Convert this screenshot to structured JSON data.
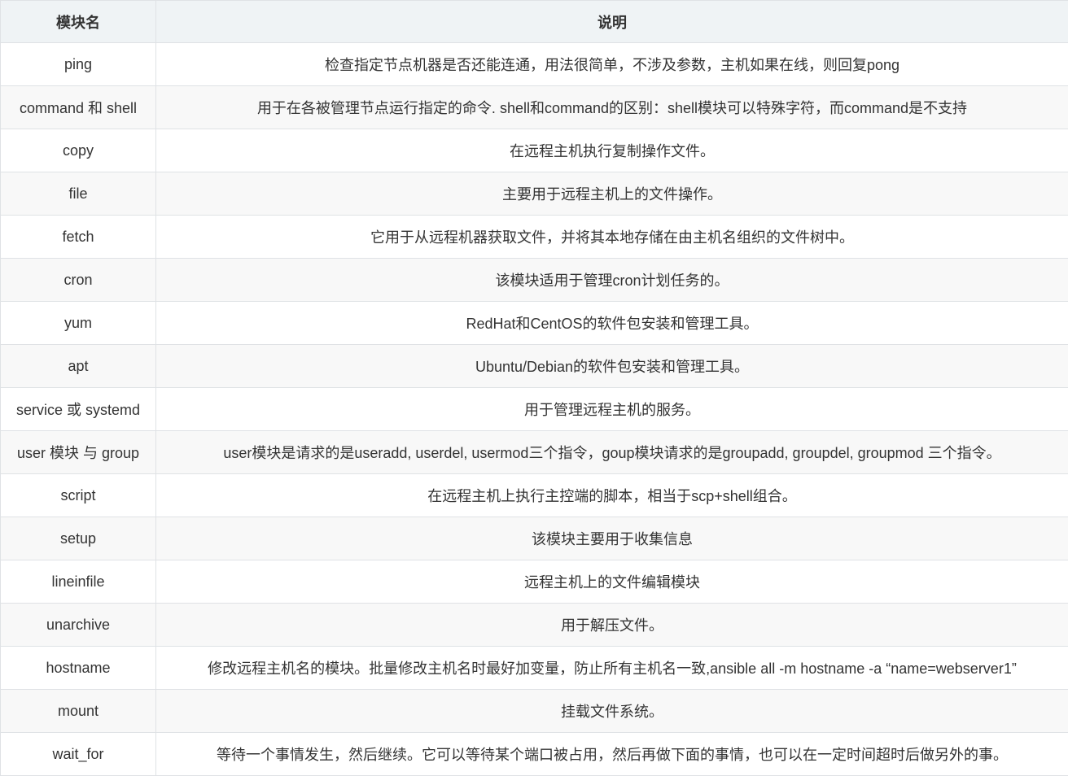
{
  "header": {
    "col1": "模块名",
    "col2": "说明"
  },
  "rows": [
    {
      "name": "ping",
      "desc": "检查指定节点机器是否还能连通，用法很简单，不涉及参数，主机如果在线，则回复pong"
    },
    {
      "name": "command 和 shell",
      "desc": "用于在各被管理节点运行指定的命令. shell和command的区别：shell模块可以特殊字符，而command是不支持"
    },
    {
      "name": "copy",
      "desc": "在远程主机执行复制操作文件。"
    },
    {
      "name": "file",
      "desc": "主要用于远程主机上的文件操作。"
    },
    {
      "name": "fetch",
      "desc": "它用于从远程机器获取文件，并将其本地存储在由主机名组织的文件树中。"
    },
    {
      "name": "cron",
      "desc": "该模块适用于管理cron计划任务的。"
    },
    {
      "name": "yum",
      "desc": "RedHat和CentOS的软件包安装和管理工具。"
    },
    {
      "name": "apt",
      "desc": "Ubuntu/Debian的软件包安装和管理工具。"
    },
    {
      "name": "service 或 systemd",
      "desc": "用于管理远程主机的服务。"
    },
    {
      "name": "user 模块 与 group",
      "desc": "user模块是请求的是useradd, userdel, usermod三个指令，goup模块请求的是groupadd, groupdel, groupmod 三个指令。"
    },
    {
      "name": "script",
      "desc": "在远程主机上执行主控端的脚本，相当于scp+shell组合。"
    },
    {
      "name": "setup",
      "desc": "该模块主要用于收集信息"
    },
    {
      "name": "lineinfile",
      "desc": "远程主机上的文件编辑模块"
    },
    {
      "name": "unarchive",
      "desc": "用于解压文件。"
    },
    {
      "name": "hostname",
      "desc": "修改远程主机名的模块。批量修改主机名时最好加变量，防止所有主机名一致,ansible all -m hostname -a “name=webserver1”"
    },
    {
      "name": "mount",
      "desc": "挂载文件系统。"
    },
    {
      "name": "wait_for",
      "desc": "等待一个事情发生，然后继续。它可以等待某个端口被占用，然后再做下面的事情，也可以在一定时间超时后做另外的事。"
    }
  ]
}
